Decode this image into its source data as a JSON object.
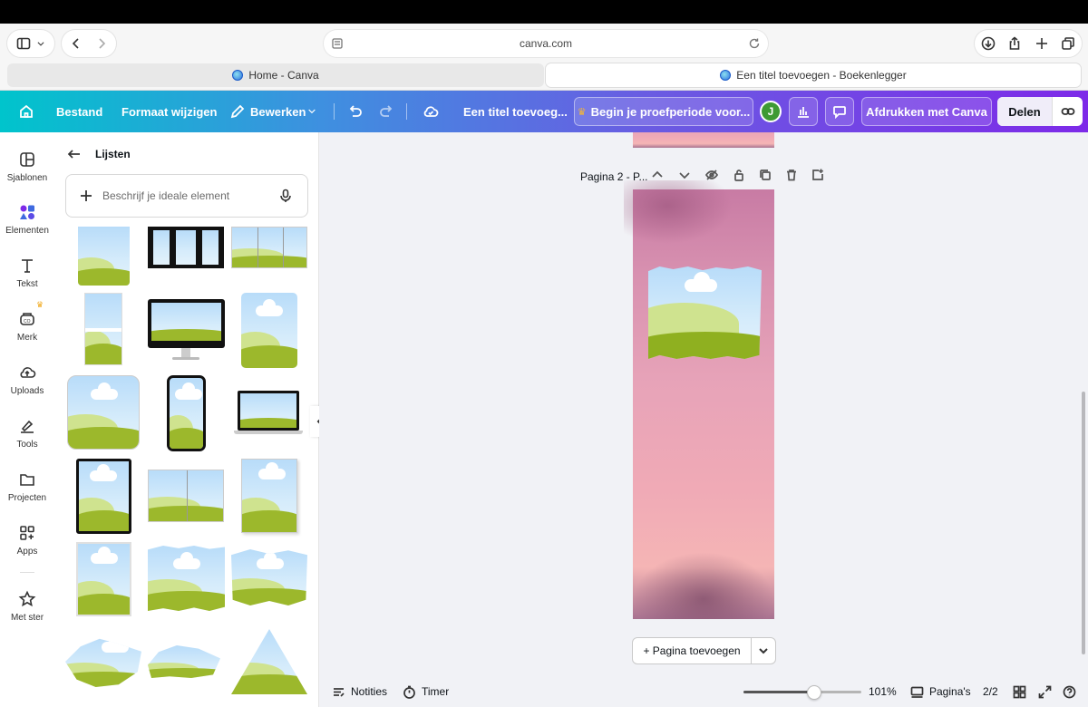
{
  "browser": {
    "url": "canva.com",
    "tabs": [
      {
        "label": "Home - Canva"
      },
      {
        "label": "Een titel toevoegen - Boekenlegger"
      }
    ]
  },
  "toolbar": {
    "file": "Bestand",
    "resize": "Formaat wijzigen",
    "edit": "Bewerken",
    "doc_title": "Een titel toevoeg...",
    "trial": "Begin je proefperiode voor...",
    "avatar_initial": "J",
    "print": "Afdrukken met Canva",
    "share": "Delen"
  },
  "rail": [
    {
      "label": "Sjablonen",
      "icon": "template-icon"
    },
    {
      "label": "Elementen",
      "icon": "elements-icon"
    },
    {
      "label": "Tekst",
      "icon": "text-icon"
    },
    {
      "label": "Merk",
      "icon": "brand-icon"
    },
    {
      "label": "Uploads",
      "icon": "upload-icon"
    },
    {
      "label": "Tools",
      "icon": "pen-icon"
    },
    {
      "label": "Projecten",
      "icon": "folder-icon"
    },
    {
      "label": "Apps",
      "icon": "apps-icon"
    },
    {
      "label": "Met ster",
      "icon": "star-icon"
    }
  ],
  "panel": {
    "title": "Lijsten",
    "search_placeholder": "Beschrijf je ideale element"
  },
  "canvas": {
    "page_label": "Pagina 2 - P...",
    "add_page": "+ Pagina toevoegen"
  },
  "bottom": {
    "notes": "Notities",
    "timer": "Timer",
    "zoom": "101%",
    "zoom_slider_fraction": 0.6,
    "pages": "Pagina's",
    "page_count": "2/2"
  },
  "colors": {
    "brand_gradient_start": "#00c4cc",
    "brand_gradient_end": "#7d2ae8",
    "avatar": "#3e9a34"
  }
}
